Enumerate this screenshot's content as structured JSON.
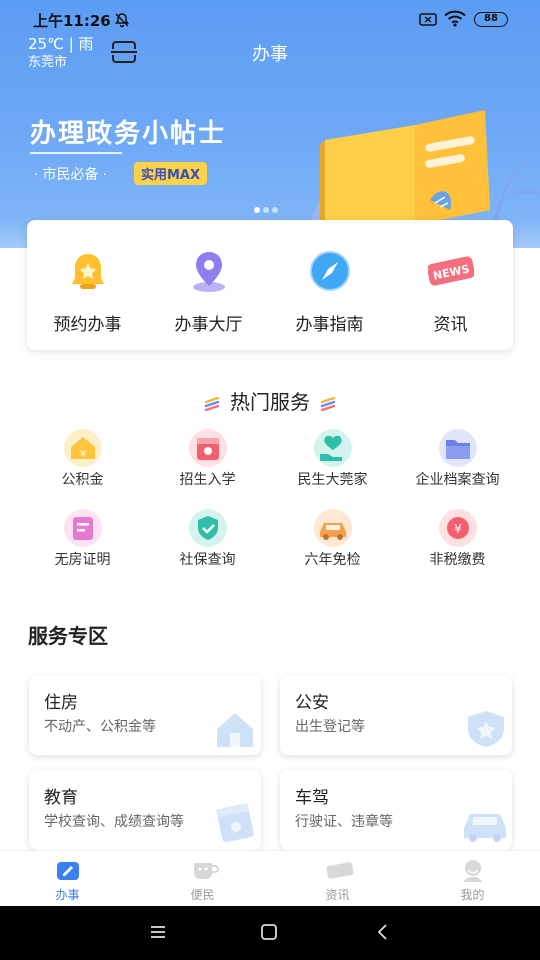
{
  "status_bar": {
    "time": "上午11:26",
    "battery": "88"
  },
  "header": {
    "temperature": "25℃ | 雨",
    "city": "东莞市",
    "title": "办事"
  },
  "banner": {
    "headline": "办理政务小帖士",
    "subtitle": "市民必备",
    "badge": "实用MAX"
  },
  "quick_actions": [
    {
      "label": "预约办事",
      "icon": "bell-icon"
    },
    {
      "label": "办事大厅",
      "icon": "location-pin-icon"
    },
    {
      "label": "办事指南",
      "icon": "compass-icon"
    },
    {
      "label": "资讯",
      "icon": "news-icon",
      "icon_text": "NEWS"
    }
  ],
  "hot_services": {
    "title": "热门服务",
    "items": [
      {
        "label": "公积金",
        "icon": "housing-fund-icon"
      },
      {
        "label": "招生入学",
        "icon": "enrollment-icon"
      },
      {
        "label": "民生大莞家",
        "icon": "livelihood-icon"
      },
      {
        "label": "企业档案查询",
        "icon": "folder-icon"
      },
      {
        "label": "无房证明",
        "icon": "certificate-icon"
      },
      {
        "label": "社保查询",
        "icon": "shield-icon"
      },
      {
        "label": "六年免检",
        "icon": "car-icon"
      },
      {
        "label": "非税缴费",
        "icon": "payment-icon"
      }
    ]
  },
  "service_zone": {
    "title": "服务专区",
    "cards": [
      {
        "title": "住房",
        "subtitle": "不动产、公积金等",
        "icon": "house-icon"
      },
      {
        "title": "公安",
        "subtitle": "出生登记等",
        "icon": "police-badge-icon"
      },
      {
        "title": "教育",
        "subtitle": "学校查询、成绩查询等",
        "icon": "book-icon"
      },
      {
        "title": "车驾",
        "subtitle": "行驶证、违章等",
        "icon": "car-icon"
      }
    ]
  },
  "tabbar": [
    {
      "label": "办事",
      "active": true
    },
    {
      "label": "便民",
      "active": false
    },
    {
      "label": "资讯",
      "active": false
    },
    {
      "label": "我的",
      "active": false
    }
  ],
  "colors": {
    "primary": "#3a7ff0",
    "banner": "#6ea9f6",
    "badge": "#fbd24a"
  }
}
